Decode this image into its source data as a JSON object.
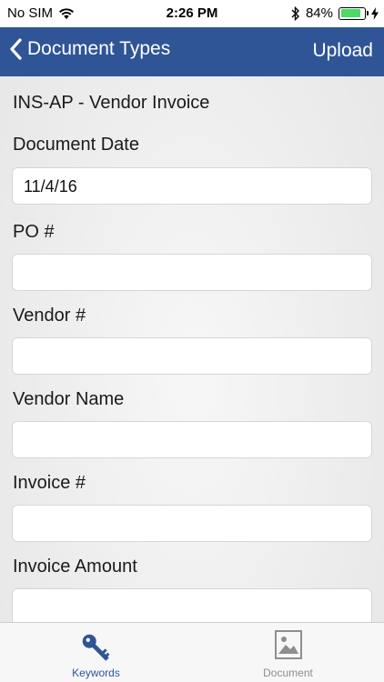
{
  "status_bar": {
    "carrier": "No SIM",
    "time": "2:26 PM",
    "battery_percent": "84%",
    "battery_level": 0.84
  },
  "nav": {
    "back_label": "Document Types",
    "action_label": "Upload",
    "bar_color": "#2f5597"
  },
  "form": {
    "document_type": "INS-AP - Vendor Invoice",
    "fields": [
      {
        "label": "Document Date",
        "value": "11/4/16"
      },
      {
        "label": "PO #",
        "value": ""
      },
      {
        "label": "Vendor #",
        "value": ""
      },
      {
        "label": "Vendor Name",
        "value": ""
      },
      {
        "label": "Invoice #",
        "value": ""
      },
      {
        "label": "Invoice Amount",
        "value": ""
      }
    ]
  },
  "tabs": [
    {
      "label": "Keywords",
      "icon": "key-icon",
      "active": true,
      "color": "#2f5597"
    },
    {
      "label": "Document",
      "icon": "image-icon",
      "active": false,
      "color": "#8e8e8e"
    }
  ]
}
